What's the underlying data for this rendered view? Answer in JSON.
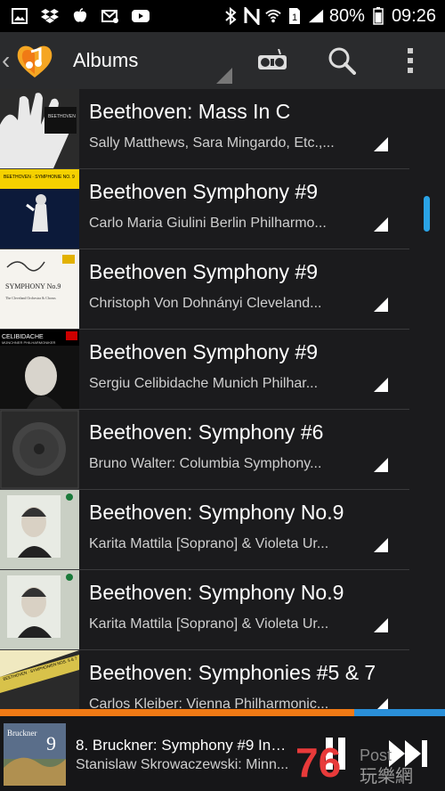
{
  "status_bar": {
    "battery": "80%",
    "time": "09:26",
    "left_icons": [
      "gallery-icon",
      "dropbox-icon",
      "apple-icon",
      "email-icon",
      "youtube-icon"
    ],
    "right_icons": [
      "bluetooth-icon",
      "nfc-icon",
      "wifi-icon",
      "sim-icon",
      "signal-icon",
      "battery-icon"
    ]
  },
  "action_bar": {
    "title": "Albums",
    "icons": [
      "back-chevron-icon",
      "app-logo-icon",
      "radio-icon",
      "search-icon",
      "overflow-menu-icon"
    ]
  },
  "albums": [
    {
      "title": "Beethoven: Mass In C",
      "subtitle": "Sally Matthews, Sara Mingardo, Etc.,..."
    },
    {
      "title": "Beethoven  Symphony #9",
      "subtitle": "Carlo Maria Giulini  Berlin Philharmo..."
    },
    {
      "title": "Beethoven  Symphony #9",
      "subtitle": "Christoph Von Dohnányi  Cleveland..."
    },
    {
      "title": "Beethoven  Symphony #9",
      "subtitle": "Sergiu Celibidache  Munich Philhar..."
    },
    {
      "title": "Beethoven: Symphony #6",
      "subtitle": "Bruno Walter: Columbia Symphony..."
    },
    {
      "title": "Beethoven: Symphony No.9",
      "subtitle": "Karita Mattila [Soprano] & Violeta Ur..."
    },
    {
      "title": "Beethoven: Symphony No.9",
      "subtitle": "Karita Mattila [Soprano] & Violeta Ur..."
    },
    {
      "title": "Beethoven: Symphonies #5 & 7",
      "subtitle": "Carlos Kleiber: Vienna Philharmonic..."
    }
  ],
  "album_art_text": {
    "art1": "BEETHOVEN",
    "art2": "BEETHOVEN · SYMPHONIE NO. 9",
    "art3": "SYMPHONY No.9",
    "art3_sub": "The Cleveland Orchestra & Chorus",
    "art4_label": "CELIBIDACHE",
    "art4_sub": "MÜNCHNER PHILHARMONIKER",
    "art8": "BEETHOVEN · SYMPHONIEN NOS. 5 & 7"
  },
  "playback": {
    "progress": 0.795,
    "colors": {
      "played": "#f07a15",
      "remaining": "#2a8fd8"
    }
  },
  "now_playing": {
    "art_text": "Bruckner",
    "art_number": "9",
    "title": "8. Bruckner: Symphony #9 In D...",
    "subtitle": "Stanislaw Skrowaczewski: Minn..."
  },
  "watermark": {
    "text": "Post76 玩樂網",
    "number": "76"
  }
}
